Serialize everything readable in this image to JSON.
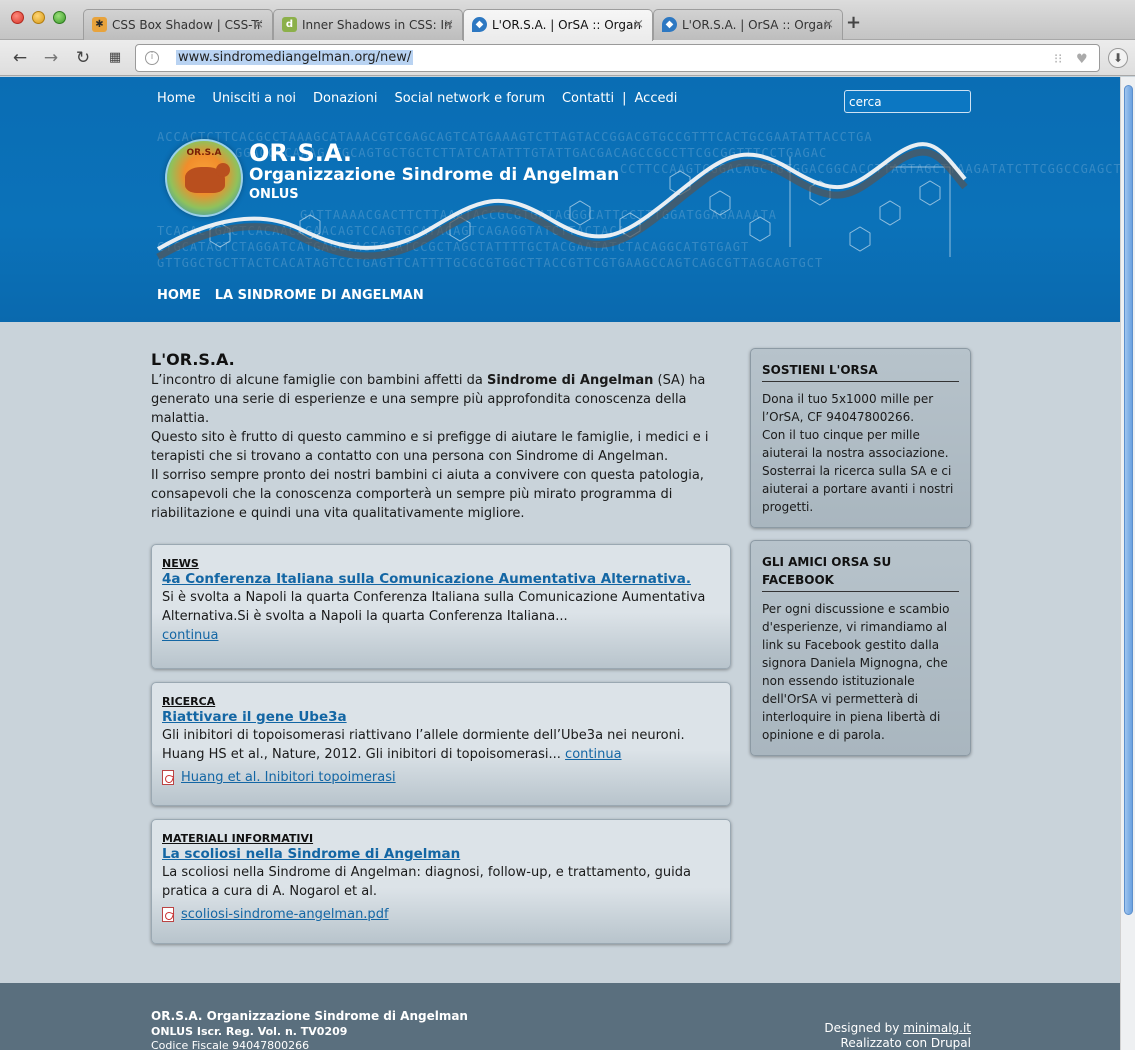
{
  "browser": {
    "tabs": [
      {
        "title": "CSS Box Shadow | CSS-Tricks",
        "favicon": "css-tricks-star"
      },
      {
        "title": "Inner Shadows in CSS: Images",
        "favicon": "d-icon"
      },
      {
        "title": "L'OR.S.A. | OrSA :: Organizzazione",
        "favicon": "drupal-drop",
        "active": true
      },
      {
        "title": "L'OR.S.A. | OrSA :: Organizzazione",
        "favicon": "drupal-drop"
      }
    ],
    "url": "www.sindromediangelman.org/new/"
  },
  "header": {
    "nav": [
      "Home",
      "Unisciti a noi",
      "Donazioni",
      "Social network e forum",
      "Contatti",
      "Accedi"
    ],
    "nav_separator": "|",
    "search_placeholder": "cerca",
    "logo_text": "OR.S.A",
    "org_title": "OR.S.A.",
    "org_subtitle": "Organizzazione Sindrome di Angelman",
    "org_onlus": "ONLUS",
    "dna_lines": [
      "ACCACTCTTCACGCCTAAAGCATAAACGTCGAGCAGTCATGAAAGTCTTAGTACCGGACGTGCCGTTTCACTGCGAATATTACCTGA",
      "GGAGCGCAAAGATGCAGTGCTGCTCTTATCATATTTGTATTGACGACAGCCGCCTTCGCGGTTTCCTGAGAC",
      "CCTTCCAAGTCGGACAGCTGTGGACGGCACCTTAGTAGCTTAAGATATCTTCGGCCGAGCTTGGTATTAAA",
      "GATTAAAACGACTTCTTAAATACCGCGTGATAGGGCATTCCTTTGGATGGAGAAAATA",
      "TCAGACTGACTCACAACAGAACAGTCCAGTGCATACAGTCAGAGGTATCTTACTACA",
      "CTGCATAGTCTAGGATCATGAGCTAGTGCATCCGCTAGCTATTTTGCTACGAATATCTACAGGCATGTGAGT",
      "GTTGGCTGCTTACTCACATAGTCCTGAGTTCATTTTGCGCGTGGCTTACCGTTCGTGAAGCCAGTCAGCGTTAGCAGTGCT"
    ],
    "main_nav": [
      "HOME",
      "LA SINDROME DI ANGELMAN"
    ]
  },
  "intro": {
    "title": "L'OR.S.A.",
    "p1_before": "L’incontro di alcune famiglie con bambini affetti da ",
    "p1_bold": "Sindrome di Angelman",
    "p1_after": " (SA) ha generato una serie di esperienze e una sempre più approfondita conoscenza della malattia.",
    "p2": "Questo sito è frutto di questo cammino e si prefigge di aiutare le famiglie, i medici e i terapisti che si trovano a contatto con una persona con Sindrome di Angelman.",
    "p3": "Il sorriso sempre pronto dei nostri bambini ci aiuta a convivere con questa patologia, consapevoli che la conoscenza comporterà un sempre più mirato programma di riabilitazione e quindi una vita qualitativamente migliore."
  },
  "cards": [
    {
      "category": "NEWS",
      "title": "4a Conferenza Italiana sulla Comunicazione Aumentativa Alternativa.",
      "text": "Si è svolta a Napoli la quarta Conferenza Italiana sulla Comunicazione Aumentativa Alternativa.Si è svolta a Napoli la quarta Conferenza Italiana...",
      "more": "continua"
    },
    {
      "category": "RICERCA",
      "title": "Riattivare il gene Ube3a",
      "text": "Gli inibitori di topoisomerasi riattivano l’allele dormiente dell’Ube3a nei neuroni. Huang HS et al., Nature, 2012. Gli inibitori di topoisomerasi...",
      "more": "continua",
      "attachment": "Huang et al. Inibitori topoimerasi"
    },
    {
      "category": "MATERIALI INFORMATIVI",
      "title": "La scoliosi nella Sindrome di Angelman",
      "text": "La scoliosi nella Sindrome di Angelman: diagnosi, follow-up, e trattamento, guida pratica a cura di A. Nogarol et al.",
      "attachment": "scoliosi-sindrome-angelman.pdf"
    }
  ],
  "sidebar": [
    {
      "title": "SOSTIENI L'ORSA",
      "text": "Dona il tuo 5x1000 mille per l’OrSA, CF 94047800266.\nCon il tuo cinque per mille aiuterai la nostra associazione. Sosterrai la ricerca sulla SA e ci aiuterai a portare avanti i nostri progetti."
    },
    {
      "title": "GLI AMICI ORSA SU FACEBOOK",
      "text": "Per ogni discussione e scambio d'esperienze, vi rimandiamo al link su Facebook gestito dalla signora Daniela Mignogna, che non essendo istituzionale dell'OrSA vi permetterà di interloquire in piena libertà di opinione e di parola."
    }
  ],
  "footer": {
    "line1": "OR.S.A. Organizzazione Sindrome di Angelman",
    "line2": "ONLUS Iscr. Reg. Vol. n. TV0209",
    "line3": "Codice Fiscale 94047800266",
    "designed_prefix": "Designed by ",
    "designed_link": "minimalg.it",
    "realized": "Realizzato con Drupal"
  },
  "colors": {
    "header_blue": "#0b72b9",
    "link_blue": "#1366a4",
    "page_bg": "#c9d3da",
    "footer_bg": "#5a6f7e"
  }
}
